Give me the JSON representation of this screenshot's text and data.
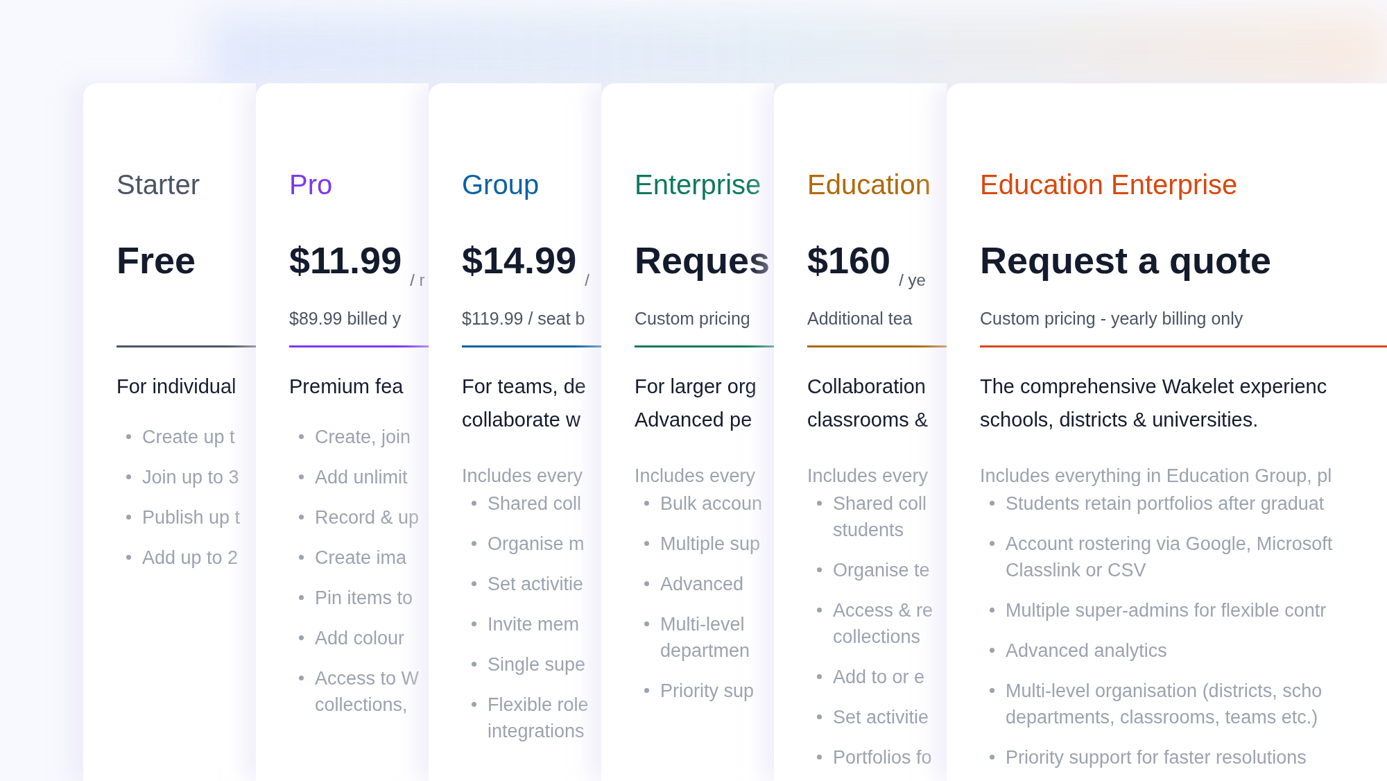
{
  "plans": [
    {
      "name": "Starter",
      "color": "#4b5563",
      "price": "Free",
      "description": [
        "For individual"
      ],
      "features": [
        {
          "lines": [
            "Create up t"
          ]
        },
        {
          "lines": [
            "Join up to 3"
          ]
        },
        {
          "lines": [
            "Publish up t"
          ]
        },
        {
          "lines": [
            "Add up to 2"
          ]
        }
      ]
    },
    {
      "name": "Pro",
      "color": "#7c3aed",
      "price": "$11.99",
      "period": "/ r",
      "billing": "$89.99 billed y",
      "description": [
        "Premium fea"
      ],
      "features": [
        {
          "lines": [
            "Create, join"
          ]
        },
        {
          "lines": [
            "Add unlimit"
          ]
        },
        {
          "lines": [
            "Record & up"
          ]
        },
        {
          "lines": [
            "Create ima"
          ]
        },
        {
          "lines": [
            "Pin items to"
          ]
        },
        {
          "lines": [
            "Add colour"
          ]
        },
        {
          "lines": [
            "Access to W",
            "collections,"
          ]
        }
      ]
    },
    {
      "name": "Group",
      "color": "#0b62a4",
      "price": "$14.99",
      "period": "/",
      "billing": "$119.99 / seat b",
      "description": [
        "For teams, de",
        "collaborate w"
      ],
      "includes": "Includes every",
      "features": [
        {
          "lines": [
            "Shared coll"
          ]
        },
        {
          "lines": [
            "Organise m"
          ]
        },
        {
          "lines": [
            "Set activitie"
          ]
        },
        {
          "lines": [
            "Invite mem"
          ]
        },
        {
          "lines": [
            "Single supe"
          ]
        },
        {
          "lines": [
            "Flexible role",
            "integrations"
          ]
        }
      ]
    },
    {
      "name": "Enterprise",
      "color": "#0f7a5c",
      "price": "Reques",
      "billing": "Custom pricing",
      "description": [
        "For larger org",
        "Advanced pe"
      ],
      "includes": "Includes every",
      "features": [
        {
          "lines": [
            "Bulk accoun"
          ]
        },
        {
          "lines": [
            "Multiple sup"
          ]
        },
        {
          "lines": [
            "Advanced"
          ]
        },
        {
          "lines": [
            "Multi-level",
            "departmen"
          ]
        },
        {
          "lines": [
            "Priority sup"
          ]
        }
      ]
    },
    {
      "name": "Education",
      "color": "#b0690b",
      "price": "$160",
      "period": "/ ye",
      "billing": "Additional tea",
      "description": [
        "Collaboration",
        "classrooms &"
      ],
      "includes": "Includes every",
      "features": [
        {
          "lines": [
            "Shared coll",
            "students"
          ]
        },
        {
          "lines": [
            "Organise te"
          ]
        },
        {
          "lines": [
            "Access & re",
            "collections"
          ]
        },
        {
          "lines": [
            "Add to or e"
          ]
        },
        {
          "lines": [
            "Set activitie"
          ]
        },
        {
          "lines": [
            "Portfolios fo"
          ]
        }
      ]
    },
    {
      "name": "Education Enterprise",
      "color": "#d9480f",
      "price": "Request a quote",
      "billing": "Custom pricing - yearly billing only",
      "description": [
        "The comprehensive Wakelet experienc",
        "schools, districts & universities."
      ],
      "includes": "Includes everything in Education Group, pl",
      "features": [
        {
          "lines": [
            "Students retain portfolios after graduat"
          ]
        },
        {
          "lines": [
            "Account rostering via Google, Microsoft",
            "Classlink or CSV"
          ]
        },
        {
          "lines": [
            "Multiple super-admins for flexible contr"
          ]
        },
        {
          "lines": [
            "Advanced analytics"
          ]
        },
        {
          "lines": [
            "Multi-level organisation (districts, scho",
            "departments, classrooms, teams etc.)"
          ]
        },
        {
          "lines": [
            "Priority support for faster resolutions"
          ]
        }
      ]
    }
  ]
}
